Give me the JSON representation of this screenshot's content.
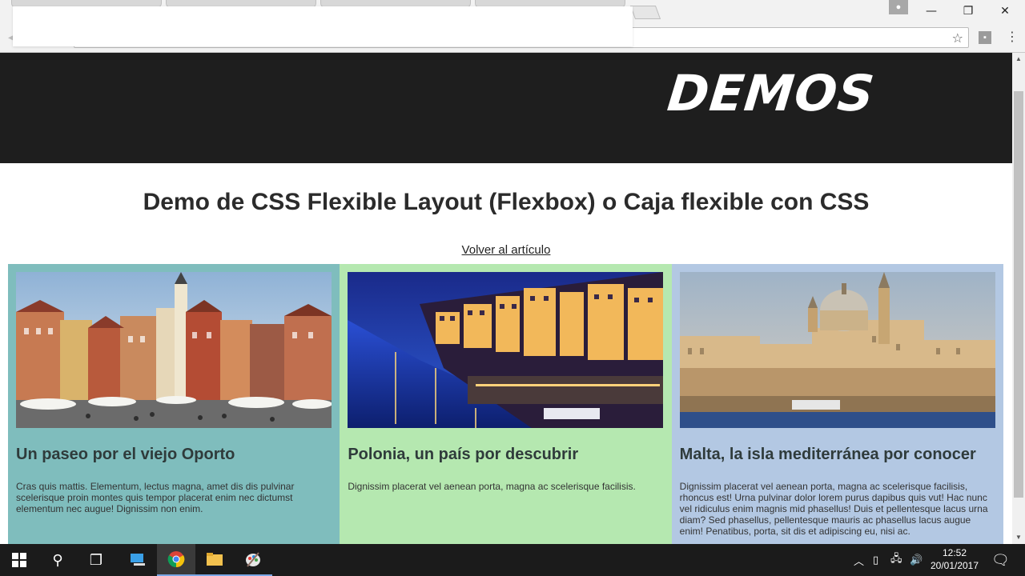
{
  "browser": {
    "profile_icon": "person-icon",
    "window_controls": {
      "minimize": "—",
      "restore": "❐",
      "close": "✕"
    }
  },
  "page": {
    "logo": "DEMOS",
    "title": "Demo de CSS Flexible Layout (Flexbox) o Caja flexible con CSS",
    "back_link": "Volver al artículo",
    "cards": [
      {
        "title": "Un paseo por el viejo Oporto",
        "text": "Cras quis mattis. Elementum, lectus magna, amet dis dis pulvinar scelerisque proin montes quis tempor placerat enim nec dictumst elementum nec augue! Dignissim non enim.",
        "bg": "#7fbdbd"
      },
      {
        "title": "Polonia, un país por descubrir",
        "text": "Dignissim placerat vel aenean porta, magna ac scelerisque facilisis.",
        "bg": "#b5e8b0"
      },
      {
        "title": "Malta, la isla mediterránea por conocer",
        "text": "Dignissim placerat vel aenean porta, magna ac scelerisque facilisis, rhoncus est! Urna pulvinar dolor lorem purus dapibus quis vut! Hac nunc vel ridiculus enim magnis mid phasellus! Duis et pellentesque lacus urna diam? Sed phasellus, pellentesque mauris ac phasellus lacus augue enim! Penatibus, porta, sit dis et adipiscing eu, nisi ac.",
        "bg": "#b3c8e3"
      }
    ]
  },
  "taskbar": {
    "time": "12:52",
    "date": "20/01/2017"
  }
}
